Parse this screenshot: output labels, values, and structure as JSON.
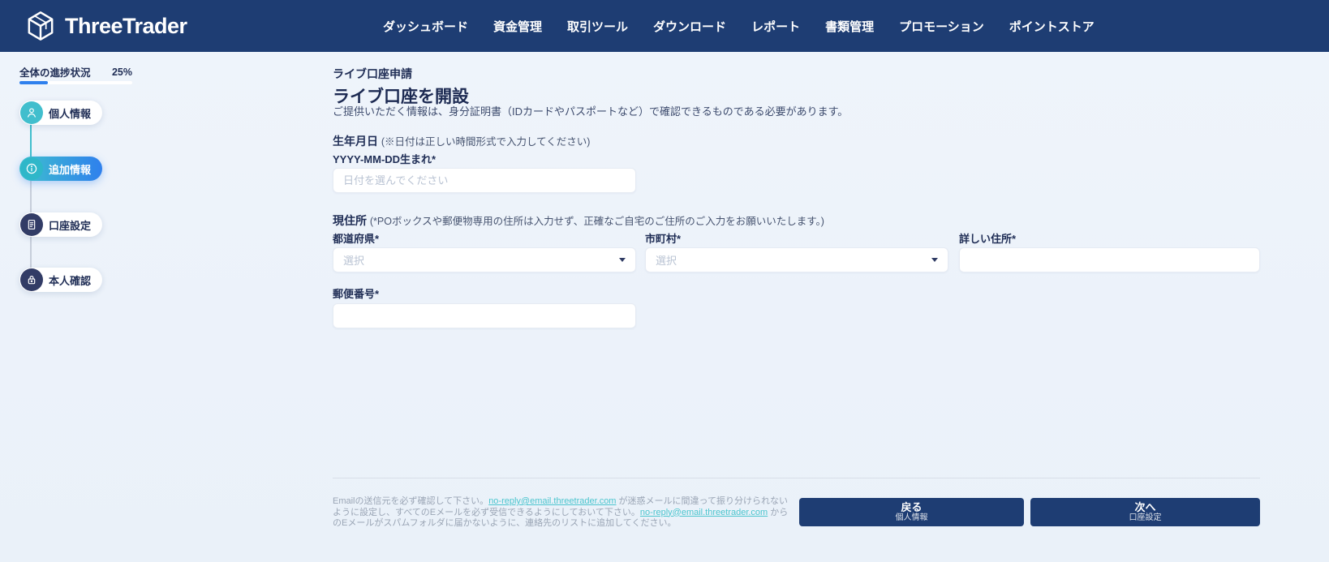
{
  "brand": {
    "name": "ThreeTrader"
  },
  "nav": {
    "items": [
      {
        "label": "ダッシュボード"
      },
      {
        "label": "資金管理"
      },
      {
        "label": "取引ツール"
      },
      {
        "label": "ダウンロード"
      },
      {
        "label": "レポート"
      },
      {
        "label": "書類管理"
      },
      {
        "label": "プロモーション"
      },
      {
        "label": "ポイントストア"
      }
    ]
  },
  "sidebar": {
    "progress_label": "全体の進捗状況",
    "progress_value": "25%",
    "progress_percent": 25,
    "steps": [
      {
        "label": "個人情報",
        "icon": "person-icon",
        "state": "completed"
      },
      {
        "label": "追加情報",
        "icon": "info-icon",
        "state": "active"
      },
      {
        "label": "口座設定",
        "icon": "document-icon",
        "state": "upcoming"
      },
      {
        "label": "本人確認",
        "icon": "lock-icon",
        "state": "upcoming"
      }
    ]
  },
  "main": {
    "breadcrumb": "ライブ口座申請",
    "title": "ライブ口座を開設",
    "subtitle": "ご提供いただく情報は、身分証明書（IDカードやパスポートなど）で確認できるものである必要があります。",
    "dob": {
      "section_label": "生年月日",
      "section_note": "(※日付は正しい時間形式で入力してください)",
      "field_label": "YYYY-MM-DD生まれ*",
      "placeholder": "日付を選んでください",
      "value": ""
    },
    "address": {
      "section_label": "現住所",
      "section_note": "(*POボックスや郵便物専用の住所は入力せず、正確なご自宅のご住所のご入力をお願いいたします。)",
      "prefecture_label": "都道府県*",
      "prefecture_placeholder": "選択",
      "prefecture_value": "",
      "city_label": "市町村*",
      "city_placeholder": "選択",
      "city_value": "",
      "street_label": "詳しい住所*",
      "street_value": "",
      "postal_label": "郵便番号*",
      "postal_value": ""
    }
  },
  "footer": {
    "note_part1": "Emailの送信元を必ず確認して下さい。",
    "email_link1": "no-reply@email.threetrader.com",
    "note_part2": " が迷惑メールに間違って振り分けられないように設定し、すべてのEメールを必ず受信できるようにしておいて下さい。",
    "email_link2": "no-reply@email.threetrader.com",
    "note_part3": " からのEメールがスパムフォルダに届かないように、連絡先のリストに追加してください。",
    "back": {
      "label": "戻る",
      "sublabel": "個人情報"
    },
    "next": {
      "label": "次へ",
      "sublabel": "口座設定"
    }
  },
  "colors": {
    "navbar": "#1E3D73",
    "page_bg": "#EDF3FA",
    "accent_teal": "#41BECD",
    "accent_blue": "#2F80ED",
    "text_navy": "#1F2D55",
    "link_teal": "#4BC5CE",
    "footer_text": "#9AA5B5"
  }
}
